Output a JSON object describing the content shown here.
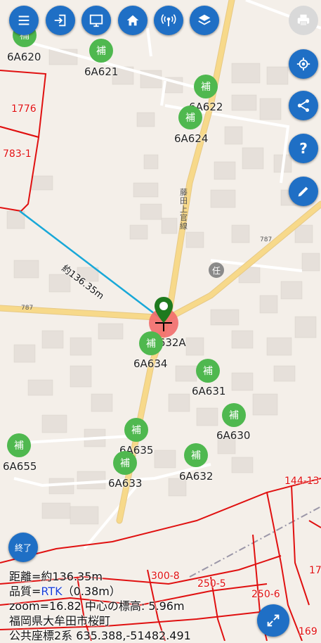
{
  "toolbar": {
    "buttons": [
      {
        "name": "menu",
        "icon": "menu-icon"
      },
      {
        "name": "login",
        "icon": "login-icon"
      },
      {
        "name": "screen",
        "icon": "monitor-icon"
      },
      {
        "name": "home",
        "icon": "home-icon"
      },
      {
        "name": "gnss",
        "icon": "antenna-icon"
      },
      {
        "name": "layers",
        "icon": "layers-icon"
      }
    ],
    "print_icon": "print-icon"
  },
  "side_buttons": [
    {
      "name": "locate",
      "icon": "gps-icon"
    },
    {
      "name": "share",
      "icon": "share-icon"
    },
    {
      "name": "help",
      "icon": "help-icon",
      "glyph": "?"
    },
    {
      "name": "edit",
      "icon": "pencil-icon"
    }
  ],
  "markers": [
    {
      "glyph": "補",
      "label": "6A620"
    },
    {
      "glyph": "補",
      "label": "6A621"
    },
    {
      "glyph": "補",
      "label": "6A622"
    },
    {
      "glyph": "補",
      "label": "6A624"
    },
    {
      "glyph": "補",
      "label": "6A632A"
    },
    {
      "glyph": "補",
      "label": "6A634"
    },
    {
      "glyph": "補",
      "label": "6A631"
    },
    {
      "glyph": "補",
      "label": "6A630"
    },
    {
      "glyph": "補",
      "label": "6A635"
    },
    {
      "glyph": "補",
      "label": "6A655"
    },
    {
      "glyph": "補",
      "label": "6A632"
    },
    {
      "glyph": "補",
      "label": "6A633"
    }
  ],
  "parcels": [
    "1776",
    "783-1",
    "144-13",
    "300-8",
    "250-5",
    "250-6",
    "169",
    "17"
  ],
  "map_labels": {
    "road_name": "藤田上官線",
    "road_number": "787",
    "poi_glyph": "任",
    "distance_label": "約136.35m"
  },
  "end_button": {
    "label": "終了"
  },
  "fullscreen_icon": "expand-icon",
  "info": {
    "distance": "距離=約136.35m",
    "quality_prefix": "品質=",
    "quality_value": "RTK",
    "quality_suffix": "（0.38m）",
    "zoom": "zoom=16.82 中心の標高: 5.96m",
    "address": "福岡県大牟田市桜町",
    "coordinates": "公共座標2系 635.388,-51482.491"
  },
  "colors": {
    "accent": "#1f6fc5",
    "marker": "#4fb84f",
    "parcel_line": "#e01010",
    "measure_line": "#18a8d8",
    "road": "#f7d98a",
    "pin": "#1e7a1e"
  }
}
